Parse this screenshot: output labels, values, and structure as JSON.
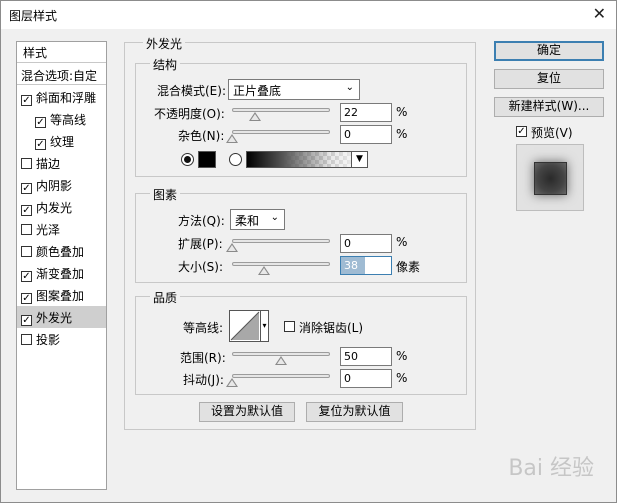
{
  "window": {
    "title": "图层样式"
  },
  "style_list": {
    "header": "样式",
    "blend_options": "混合选项:自定",
    "items": [
      {
        "label": "斜面和浮雕",
        "checked": true,
        "indent": false
      },
      {
        "label": "等高线",
        "checked": true,
        "indent": true
      },
      {
        "label": "纹理",
        "checked": true,
        "indent": true
      },
      {
        "label": "描边",
        "checked": false,
        "indent": false
      },
      {
        "label": "内阴影",
        "checked": true,
        "indent": false
      },
      {
        "label": "内发光",
        "checked": true,
        "indent": false
      },
      {
        "label": "光泽",
        "checked": false,
        "indent": false
      },
      {
        "label": "颜色叠加",
        "checked": false,
        "indent": false
      },
      {
        "label": "渐变叠加",
        "checked": true,
        "indent": false
      },
      {
        "label": "图案叠加",
        "checked": true,
        "indent": false
      },
      {
        "label": "外发光",
        "checked": true,
        "indent": false,
        "selected": true
      },
      {
        "label": "投影",
        "checked": false,
        "indent": false
      }
    ]
  },
  "outer_glow": {
    "title": "外发光",
    "structure": {
      "title": "结构",
      "blend_mode_label": "混合模式(E):",
      "blend_mode_value": "正片叠底",
      "opacity_label": "不透明度(O):",
      "opacity_value": "22",
      "opacity_unit": "%",
      "noise_label": "杂色(N):",
      "noise_value": "0",
      "noise_unit": "%"
    },
    "elements": {
      "title": "图素",
      "method_label": "方法(Q):",
      "method_value": "柔和",
      "spread_label": "扩展(P):",
      "spread_value": "0",
      "spread_unit": "%",
      "size_label": "大小(S):",
      "size_value": "38",
      "size_unit": "像素"
    },
    "quality": {
      "title": "品质",
      "contour_label": "等高线:",
      "anti_alias_label": "消除锯齿(L)",
      "range_label": "范围(R):",
      "range_value": "50",
      "range_unit": "%",
      "jitter_label": "抖动(J):",
      "jitter_value": "0",
      "jitter_unit": "%"
    },
    "set_default": "设置为默认值",
    "reset_default": "复位为默认值"
  },
  "buttons": {
    "ok": "确定",
    "reset": "复位",
    "new_style": "新建样式(W)...",
    "preview": "预览(V)"
  },
  "watermark": "Bai 经验"
}
